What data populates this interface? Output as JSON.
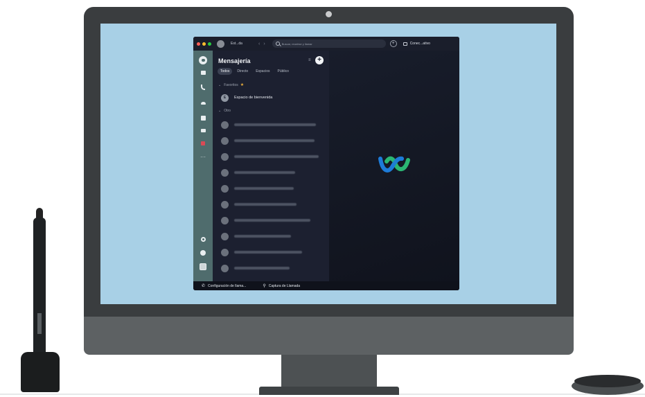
{
  "app": {
    "status_text": "Est...da",
    "search_placeholder": "Buscar, reunirse y llamar",
    "connect_label": "Conec...ativo",
    "nav_back": "‹",
    "nav_forward": "›",
    "add_symbol": "+"
  },
  "messaging": {
    "title": "Mensajería",
    "new_symbol": "+",
    "tabs": [
      {
        "label": "Todos",
        "active": true
      },
      {
        "label": "Directo",
        "active": false
      },
      {
        "label": "Espacios",
        "active": false
      },
      {
        "label": "Público",
        "active": false
      }
    ],
    "favorites_label": "Favoritos",
    "welcome_space": "Espacio de bienvenida",
    "welcome_initial": "E",
    "other_label": "Otro",
    "blurred_contacts": 11
  },
  "bottombar": {
    "call_settings": "Configuración de llama...",
    "call_pickup": "Captura de Llamada"
  },
  "icons": {
    "rail": [
      "chat-icon",
      "calendar-icon",
      "phone-icon",
      "team-icon",
      "contacts-icon",
      "meetings-icon",
      "alert-icon",
      "more-icon",
      "settings-icon",
      "help-icon",
      "profile-icon"
    ],
    "logo": "webex-logo"
  },
  "colors": {
    "screen_bg": "#a8d0e6",
    "rail": "#4f6c6d",
    "list_panel": "#1c2030",
    "logo_green": "#2bb673",
    "logo_blue": "#1d7bd8"
  }
}
